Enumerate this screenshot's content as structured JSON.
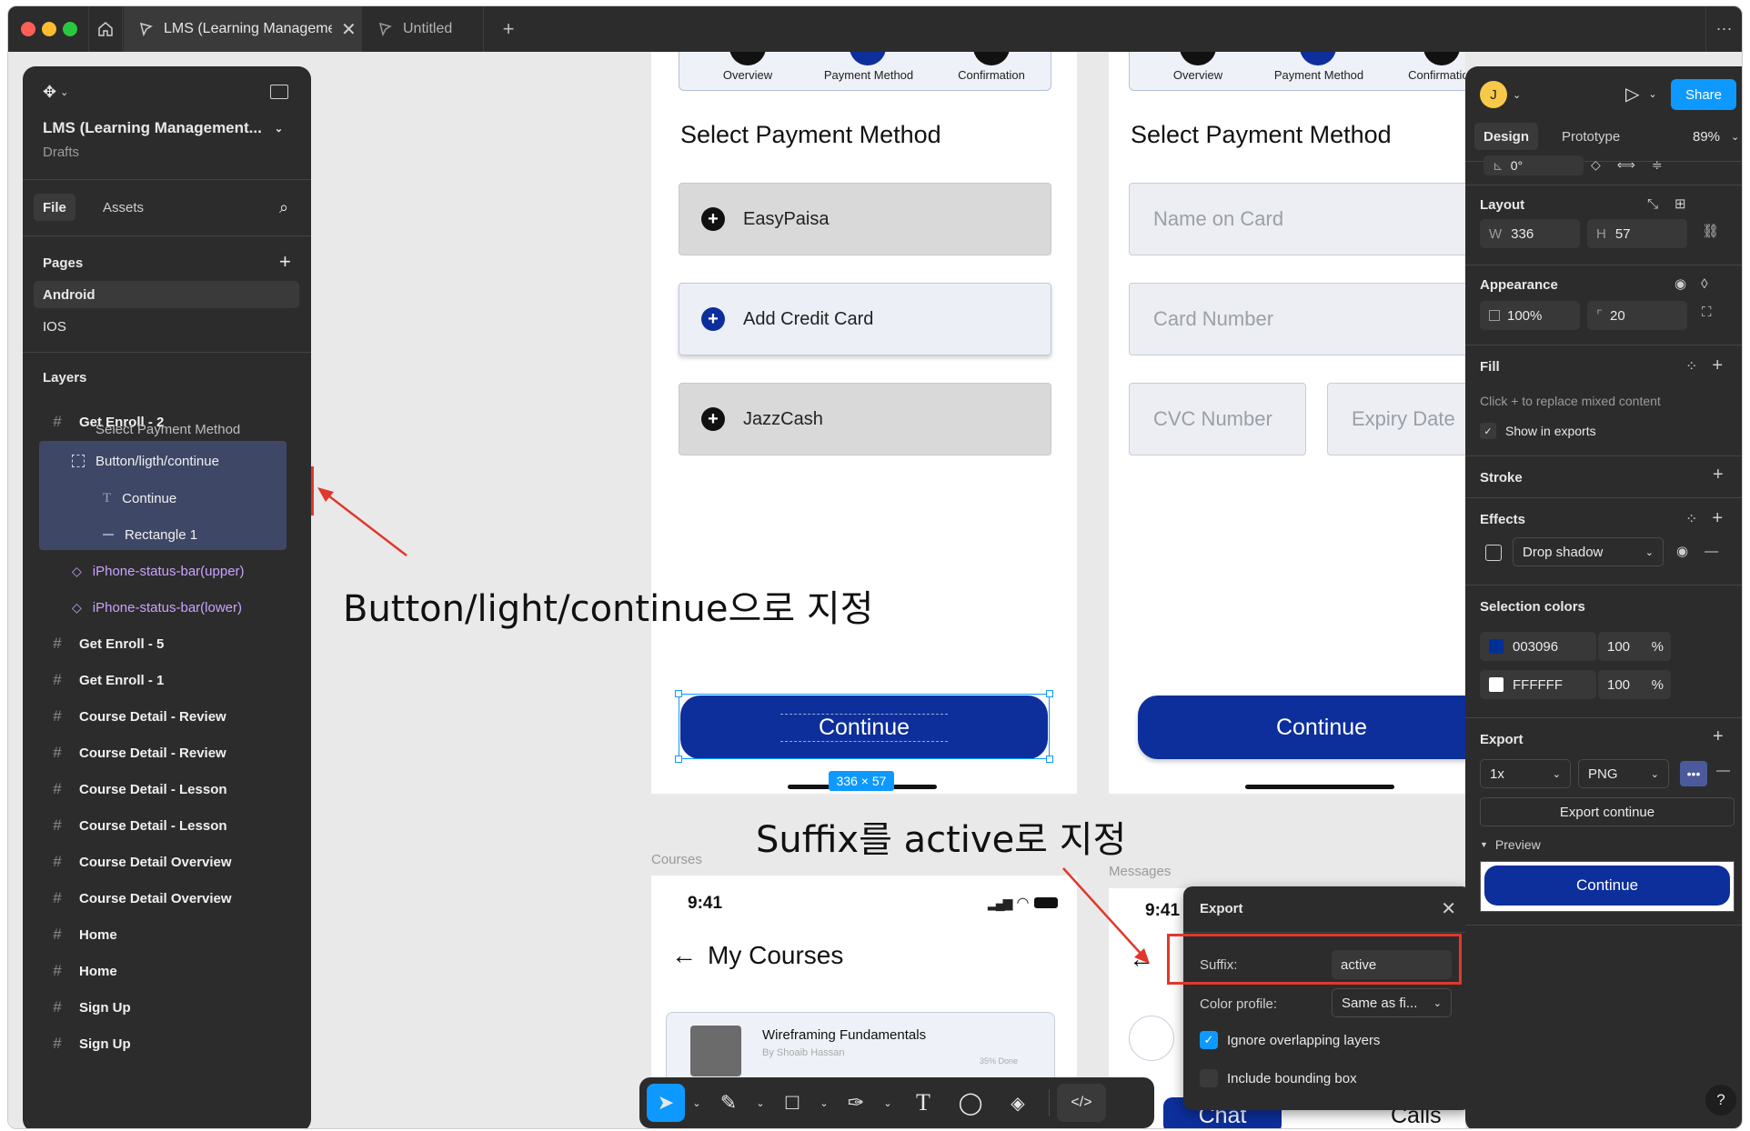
{
  "tabs": {
    "active_title": "LMS (Learning Management Syst",
    "second_title": "Untitled"
  },
  "left_panel": {
    "project_title": "LMS (Learning Management...",
    "project_sub": "Drafts",
    "file_tab": "File",
    "assets_tab": "Assets",
    "pages_label": "Pages",
    "pages": [
      "Android",
      "IOS"
    ],
    "layers_label": "Layers",
    "layer_top": "Get Enroll - 2",
    "layer_clipped": "Select Payment Method",
    "selected_layer": "Button/ligth/continue",
    "children": [
      "Continue",
      "Rectangle 1"
    ],
    "components": [
      "iPhone-status-bar(upper)",
      "iPhone-status-bar(lower)"
    ],
    "frames": [
      "Get Enroll - 5",
      "Get Enroll - 1",
      "Course Detail - Review",
      "Course Detail - Review",
      "Course Detail - Lesson",
      "Course Detail - Lesson",
      "Course Detail Overview",
      "Course Detail Overview",
      "Home",
      "Home",
      "Sign Up",
      "Sign Up"
    ]
  },
  "frame1": {
    "steps": [
      "Overview",
      "Payment Method",
      "Confirmation"
    ],
    "heading": "Select Payment Method",
    "options": [
      "EasyPaisa",
      "Add Credit Card",
      "JazzCash"
    ],
    "button": "Continue",
    "size_badge": "336 × 57"
  },
  "frame2": {
    "steps": [
      "Overview",
      "Payment Method",
      "Confirmation"
    ],
    "heading": "Select Payment Method",
    "fields": [
      "Name on Card",
      "Card Number",
      "CVC Number",
      "Expiry Date"
    ],
    "button": "Continue"
  },
  "frame3": {
    "label": "Courses",
    "time": "9:41",
    "title": "My Courses",
    "course_title": "Wireframing Fundamentals",
    "course_author": "By Shoaib Hassan",
    "course_progress": "35% Done"
  },
  "frame4": {
    "label": "Messages",
    "time": "9:41",
    "chat": "Chat",
    "calls": "Calls"
  },
  "annotations": {
    "note1": "Button/light/continue으로 지정",
    "note2": "Suffix를 active로 지정"
  },
  "export_popup": {
    "title": "Export",
    "suffix_label": "Suffix:",
    "suffix_value": "active",
    "color_profile_label": "Color profile:",
    "color_profile_value": "Same as fi...",
    "ignore_overlapping": "Ignore overlapping layers",
    "include_bbox": "Include bounding box"
  },
  "right_panel": {
    "avatar_letter": "J",
    "share": "Share",
    "design_tab": "Design",
    "prototype_tab": "Prototype",
    "zoom": "89%",
    "rotation": "0°",
    "layout_label": "Layout",
    "w_label": "W",
    "w_value": "336",
    "h_label": "H",
    "h_value": "57",
    "appearance_label": "Appearance",
    "opacity": "100%",
    "radius": "20",
    "fill_label": "Fill",
    "fill_hint": "Click + to replace mixed content",
    "show_in_exports": "Show in exports",
    "stroke_label": "Stroke",
    "effects_label": "Effects",
    "effect_type": "Drop shadow",
    "selection_colors_label": "Selection colors",
    "colors": [
      {
        "hex": "003096",
        "opacity": "100",
        "swatch": "#003096"
      },
      {
        "hex": "FFFFFF",
        "opacity": "100",
        "swatch": "#FFFFFF"
      }
    ],
    "percent": "%",
    "export_label": "Export",
    "export_scale": "1x",
    "export_format": "PNG",
    "export_button": "Export continue",
    "preview_label": "Preview",
    "preview_button": "Continue",
    "help": "?"
  },
  "colors": {
    "accent": "#0d2f9c",
    "figma_blue": "#0d99ff",
    "red_annotation": "#e0382c"
  }
}
